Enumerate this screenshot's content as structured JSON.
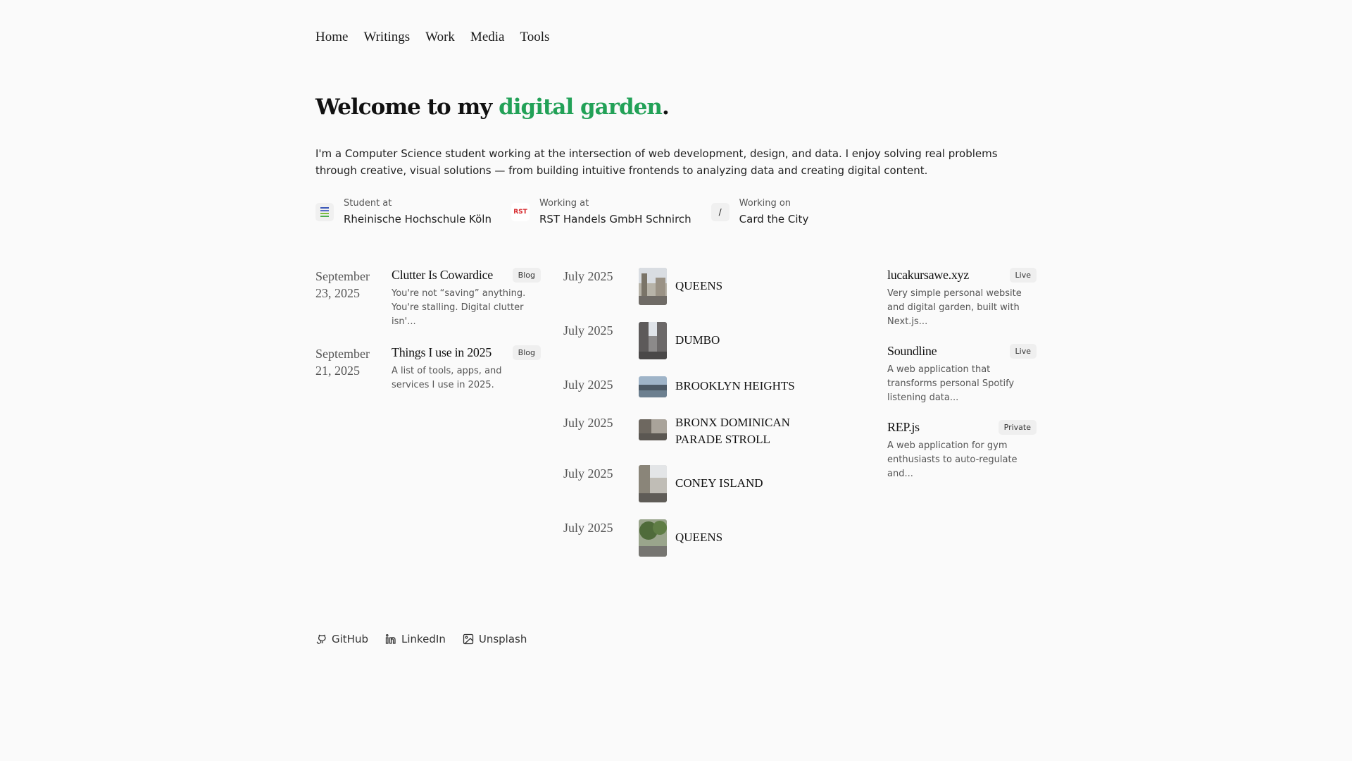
{
  "nav": {
    "items": [
      "Home",
      "Writings",
      "Work",
      "Media",
      "Tools"
    ]
  },
  "hero": {
    "title_prefix": "Welcome to my ",
    "title_accent": "digital garden",
    "title_suffix": ".",
    "accent_color": "#22a157",
    "intro": "I'm a Computer Science student working at the intersection of web development, design, and data. I enjoy solving real problems through creative, visual solutions — from building intuitive frontends to analyzing data and creating digital content."
  },
  "affiliations": [
    {
      "caption": "Student at",
      "name": "Rheinische Hochschule Köln",
      "icon": "university-logo-icon"
    },
    {
      "caption": "Working at",
      "name": "RST Handels GmbH Schnirch",
      "icon": "rst-logo-icon",
      "logo_text": "RST"
    },
    {
      "caption": "Working on",
      "name": "Card the City",
      "icon": "card-the-city-logo-icon",
      "logo_text": "/"
    }
  ],
  "writings": [
    {
      "date": "September 23, 2025",
      "title": "Clutter Is Cowardice",
      "badge": "Blog",
      "excerpt": "You're not “saving” anything. You're stalling. Digital clutter isn'..."
    },
    {
      "date": "September 21, 2025",
      "title": "Things I use in 2025",
      "badge": "Blog",
      "excerpt": "A list of tools, apps, and services I use in 2025."
    }
  ],
  "media": [
    {
      "date": "July 2025",
      "label": "QUEENS"
    },
    {
      "date": "July 2025",
      "label": "DUMBO"
    },
    {
      "date": "July 2025",
      "label": "BROOKLYN HEIGHTS"
    },
    {
      "date": "July 2025",
      "label": "BRONX DOMINICAN PARADE STROLL"
    },
    {
      "date": "July 2025",
      "label": "CONEY ISLAND"
    },
    {
      "date": "July 2025",
      "label": "QUEENS"
    }
  ],
  "work": [
    {
      "title": "lucakursawe.xyz",
      "badge": "Live",
      "excerpt": "Very simple personal website and digital garden, built with Next.js..."
    },
    {
      "title": "Soundline",
      "badge": "Live",
      "excerpt": "A web application that transforms personal Spotify listening data..."
    },
    {
      "title": "REP.js",
      "badge": "Private",
      "excerpt": "A web application for gym enthusiasts to auto-regulate and..."
    }
  ],
  "footer": {
    "links": [
      "GitHub",
      "LinkedIn",
      "Unsplash"
    ]
  }
}
